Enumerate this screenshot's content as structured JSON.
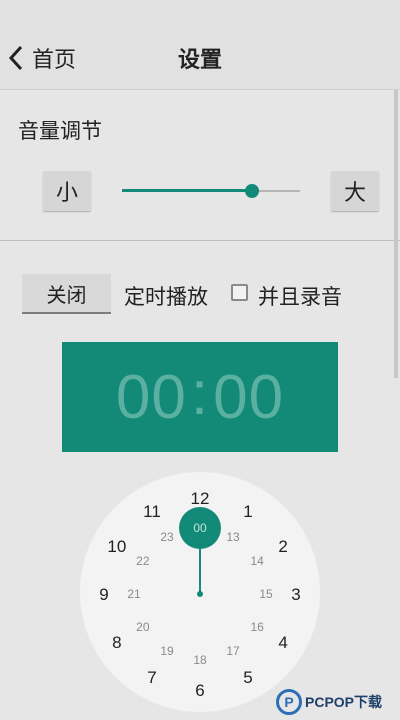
{
  "header": {
    "back_label": "首页",
    "title": "设置"
  },
  "volume": {
    "title": "音量调节",
    "min_label": "小",
    "max_label": "大",
    "level": 0.73
  },
  "timer": {
    "off_label": "关闭",
    "label": "定时播放",
    "record_label": "并且录音",
    "record_checked": false,
    "display_hours": "00",
    "display_minutes": "00"
  },
  "clock": {
    "outer": [
      "12",
      "1",
      "2",
      "3",
      "4",
      "5",
      "6",
      "7",
      "8",
      "9",
      "10",
      "11"
    ],
    "inner": [
      "00",
      "13",
      "14",
      "15",
      "16",
      "17",
      "18",
      "19",
      "20",
      "21",
      "22",
      "23"
    ],
    "selected": "00"
  },
  "colors": {
    "accent": "#138a78",
    "accent_text": "#5bb0a2"
  },
  "watermark": {
    "logo": "P",
    "text": "PCPOP下载"
  }
}
